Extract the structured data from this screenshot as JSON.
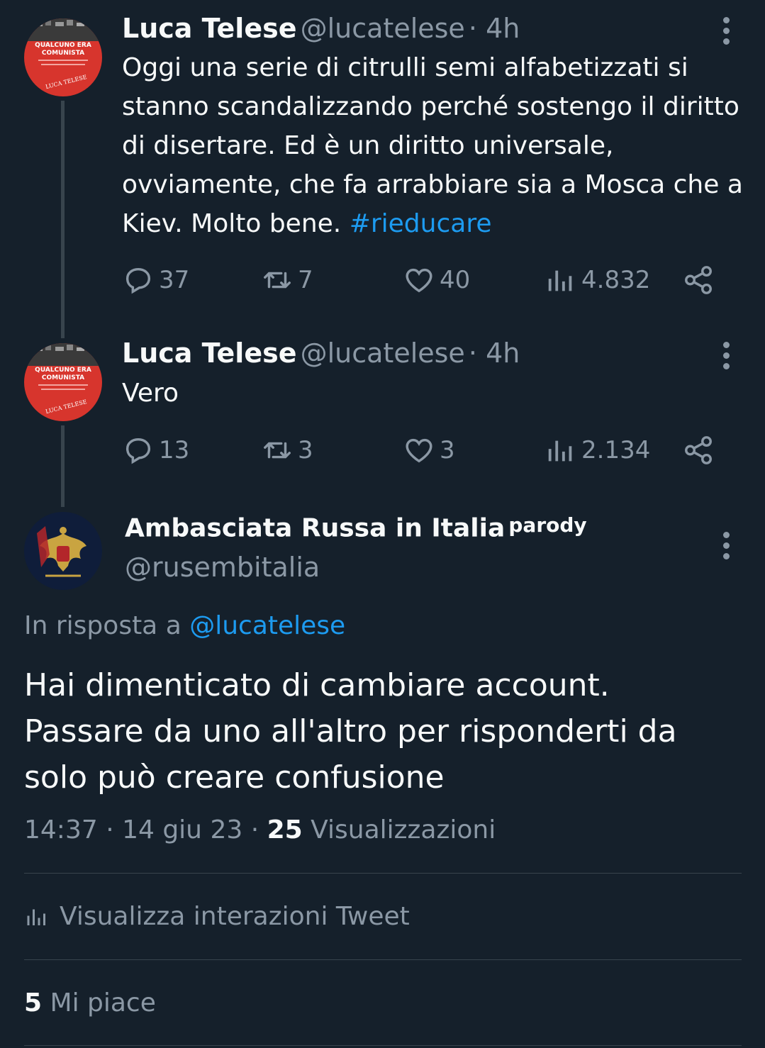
{
  "tweet1": {
    "name": "Luca Telese",
    "handle": "@lucatelese",
    "time": "· 4h",
    "text_main": "Oggi una serie di citrulli semi alfabetizzati si stanno scandalizzando perché sostengo il diritto di disertare. Ed è un diritto universale, ovviamente, che fa arrabbiare sia a Mosca che a Kiev. Molto bene.",
    "hashtag": "#rieducare",
    "replies": "37",
    "retweets": "7",
    "likes": "40",
    "views": "4.832",
    "avatar_text": [
      "QUALCUNO ERA",
      "COMUNISTA",
      "LUCA TELESE"
    ]
  },
  "tweet2": {
    "name": "Luca Telese",
    "handle": "@lucatelese",
    "time": "· 4h",
    "text": "Vero",
    "replies": "13",
    "retweets": "3",
    "likes": "3",
    "views": "2.134",
    "avatar_text": [
      "QUALCUNO ERA",
      "COMUNISTA",
      "LUCA TELESE"
    ]
  },
  "main_tweet": {
    "name": "Ambasciata Russa in Italia",
    "badge": "parody",
    "handle": "@rusembitalia",
    "reply_prefix": "In risposta a",
    "reply_to": "@lucatelese",
    "text": "Hai dimenticato di cambiare account. Passare da uno all'altro per risponderti da solo può creare confusione",
    "timestamp": "14:37 · 14 giu 23 ·",
    "views_count": "25",
    "views_label": "Visualizzazioni",
    "interactions_label": "Visualizza interazioni Tweet",
    "likes_count": "5",
    "likes_label": "Mi piace"
  },
  "colors": {
    "background": "#15202b",
    "text": "#f7f9f9",
    "secondary": "#8b98a5",
    "accent": "#1d9bf0",
    "avatar_red": "#d7352d",
    "avatar_navy": "#0f1d3a"
  },
  "icons": {
    "reply": "reply-icon",
    "retweet": "retweet-icon",
    "like": "heart-icon",
    "views": "views-icon",
    "share": "share-icon",
    "more": "more-icon"
  }
}
